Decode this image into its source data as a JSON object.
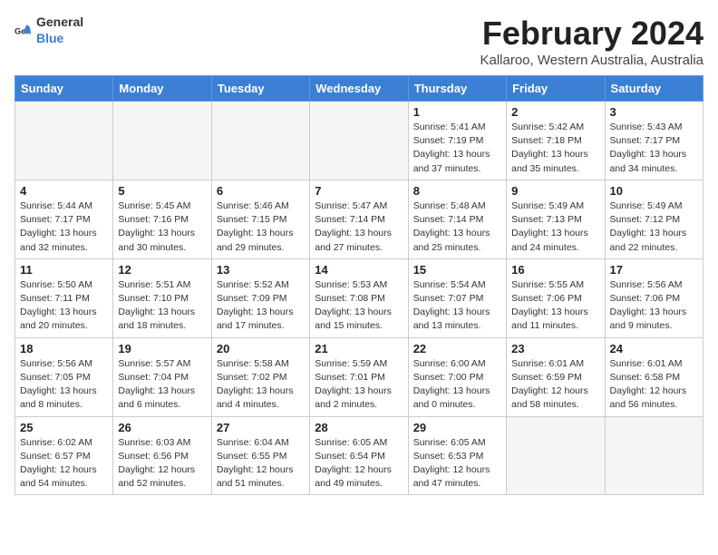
{
  "logo": {
    "general": "General",
    "blue": "Blue"
  },
  "title": "February 2024",
  "subtitle": "Kallaroo, Western Australia, Australia",
  "days_of_week": [
    "Sunday",
    "Monday",
    "Tuesday",
    "Wednesday",
    "Thursday",
    "Friday",
    "Saturday"
  ],
  "weeks": [
    [
      {
        "day": "",
        "info": ""
      },
      {
        "day": "",
        "info": ""
      },
      {
        "day": "",
        "info": ""
      },
      {
        "day": "",
        "info": ""
      },
      {
        "day": "1",
        "info": "Sunrise: 5:41 AM\nSunset: 7:19 PM\nDaylight: 13 hours\nand 37 minutes."
      },
      {
        "day": "2",
        "info": "Sunrise: 5:42 AM\nSunset: 7:18 PM\nDaylight: 13 hours\nand 35 minutes."
      },
      {
        "day": "3",
        "info": "Sunrise: 5:43 AM\nSunset: 7:17 PM\nDaylight: 13 hours\nand 34 minutes."
      }
    ],
    [
      {
        "day": "4",
        "info": "Sunrise: 5:44 AM\nSunset: 7:17 PM\nDaylight: 13 hours\nand 32 minutes."
      },
      {
        "day": "5",
        "info": "Sunrise: 5:45 AM\nSunset: 7:16 PM\nDaylight: 13 hours\nand 30 minutes."
      },
      {
        "day": "6",
        "info": "Sunrise: 5:46 AM\nSunset: 7:15 PM\nDaylight: 13 hours\nand 29 minutes."
      },
      {
        "day": "7",
        "info": "Sunrise: 5:47 AM\nSunset: 7:14 PM\nDaylight: 13 hours\nand 27 minutes."
      },
      {
        "day": "8",
        "info": "Sunrise: 5:48 AM\nSunset: 7:14 PM\nDaylight: 13 hours\nand 25 minutes."
      },
      {
        "day": "9",
        "info": "Sunrise: 5:49 AM\nSunset: 7:13 PM\nDaylight: 13 hours\nand 24 minutes."
      },
      {
        "day": "10",
        "info": "Sunrise: 5:49 AM\nSunset: 7:12 PM\nDaylight: 13 hours\nand 22 minutes."
      }
    ],
    [
      {
        "day": "11",
        "info": "Sunrise: 5:50 AM\nSunset: 7:11 PM\nDaylight: 13 hours\nand 20 minutes."
      },
      {
        "day": "12",
        "info": "Sunrise: 5:51 AM\nSunset: 7:10 PM\nDaylight: 13 hours\nand 18 minutes."
      },
      {
        "day": "13",
        "info": "Sunrise: 5:52 AM\nSunset: 7:09 PM\nDaylight: 13 hours\nand 17 minutes."
      },
      {
        "day": "14",
        "info": "Sunrise: 5:53 AM\nSunset: 7:08 PM\nDaylight: 13 hours\nand 15 minutes."
      },
      {
        "day": "15",
        "info": "Sunrise: 5:54 AM\nSunset: 7:07 PM\nDaylight: 13 hours\nand 13 minutes."
      },
      {
        "day": "16",
        "info": "Sunrise: 5:55 AM\nSunset: 7:06 PM\nDaylight: 13 hours\nand 11 minutes."
      },
      {
        "day": "17",
        "info": "Sunrise: 5:56 AM\nSunset: 7:06 PM\nDaylight: 13 hours\nand 9 minutes."
      }
    ],
    [
      {
        "day": "18",
        "info": "Sunrise: 5:56 AM\nSunset: 7:05 PM\nDaylight: 13 hours\nand 8 minutes."
      },
      {
        "day": "19",
        "info": "Sunrise: 5:57 AM\nSunset: 7:04 PM\nDaylight: 13 hours\nand 6 minutes."
      },
      {
        "day": "20",
        "info": "Sunrise: 5:58 AM\nSunset: 7:02 PM\nDaylight: 13 hours\nand 4 minutes."
      },
      {
        "day": "21",
        "info": "Sunrise: 5:59 AM\nSunset: 7:01 PM\nDaylight: 13 hours\nand 2 minutes."
      },
      {
        "day": "22",
        "info": "Sunrise: 6:00 AM\nSunset: 7:00 PM\nDaylight: 13 hours\nand 0 minutes."
      },
      {
        "day": "23",
        "info": "Sunrise: 6:01 AM\nSunset: 6:59 PM\nDaylight: 12 hours\nand 58 minutes."
      },
      {
        "day": "24",
        "info": "Sunrise: 6:01 AM\nSunset: 6:58 PM\nDaylight: 12 hours\nand 56 minutes."
      }
    ],
    [
      {
        "day": "25",
        "info": "Sunrise: 6:02 AM\nSunset: 6:57 PM\nDaylight: 12 hours\nand 54 minutes."
      },
      {
        "day": "26",
        "info": "Sunrise: 6:03 AM\nSunset: 6:56 PM\nDaylight: 12 hours\nand 52 minutes."
      },
      {
        "day": "27",
        "info": "Sunrise: 6:04 AM\nSunset: 6:55 PM\nDaylight: 12 hours\nand 51 minutes."
      },
      {
        "day": "28",
        "info": "Sunrise: 6:05 AM\nSunset: 6:54 PM\nDaylight: 12 hours\nand 49 minutes."
      },
      {
        "day": "29",
        "info": "Sunrise: 6:05 AM\nSunset: 6:53 PM\nDaylight: 12 hours\nand 47 minutes."
      },
      {
        "day": "",
        "info": ""
      },
      {
        "day": "",
        "info": ""
      }
    ]
  ]
}
